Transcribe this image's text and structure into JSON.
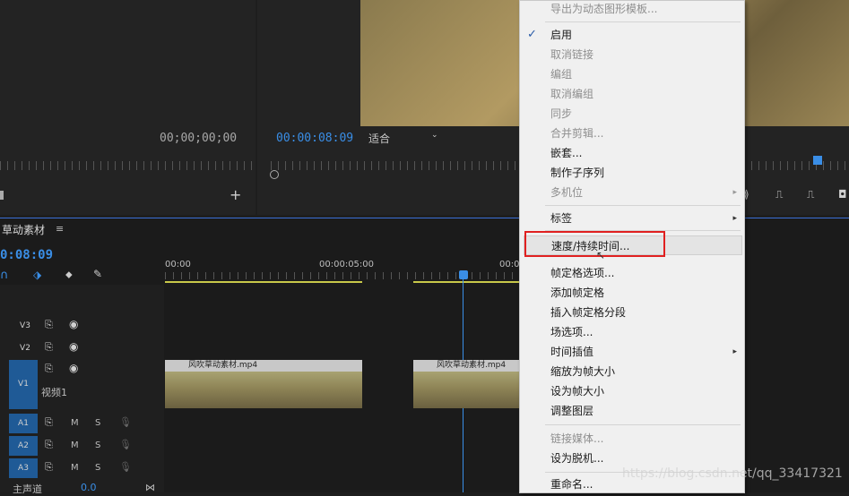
{
  "source": {
    "timecode": "00;00;00;00"
  },
  "program": {
    "timecode": "00:00:08:09",
    "fit": "适合"
  },
  "timeline": {
    "title": "草动素材",
    "timecode": "0:08:09",
    "ruler": [
      "00:00",
      "00:00:05:00",
      "00:0"
    ],
    "tracks": {
      "v3": "V3",
      "v2": "V2",
      "v1": "V1",
      "v1_name": "视频1",
      "a1": "A1",
      "a2": "A2",
      "a3": "A3",
      "m": "M",
      "s": "S",
      "master": "主声道",
      "master_val": "0.0"
    },
    "clips": [
      "风吹草动素材.mp4",
      "风吹草动素材.mp4"
    ]
  },
  "menu": {
    "items": [
      {
        "label": "导出为动态图形模板...",
        "enabled": false
      },
      {
        "label": "启用",
        "enabled": true,
        "checked": true
      },
      {
        "label": "取消链接",
        "enabled": false
      },
      {
        "label": "编组",
        "enabled": false
      },
      {
        "label": "取消编组",
        "enabled": false
      },
      {
        "label": "同步",
        "enabled": false
      },
      {
        "label": "合并剪辑...",
        "enabled": false
      },
      {
        "label": "嵌套...",
        "enabled": true
      },
      {
        "label": "制作子序列",
        "enabled": true
      },
      {
        "label": "多机位",
        "enabled": false,
        "submenu": true
      },
      {
        "label": "标签",
        "enabled": true,
        "submenu": true
      },
      {
        "label": "速度/持续时间...",
        "enabled": true,
        "highlighted": true
      },
      {
        "label": "帧定格选项...",
        "enabled": true
      },
      {
        "label": "添加帧定格",
        "enabled": true
      },
      {
        "label": "插入帧定格分段",
        "enabled": true
      },
      {
        "label": "场选项...",
        "enabled": true
      },
      {
        "label": "时间插值",
        "enabled": true,
        "submenu": true
      },
      {
        "label": "缩放为帧大小",
        "enabled": true
      },
      {
        "label": "设为帧大小",
        "enabled": true
      },
      {
        "label": "调整图层",
        "enabled": true
      },
      {
        "label": "链接媒体...",
        "enabled": false
      },
      {
        "label": "设为脱机...",
        "enabled": true
      },
      {
        "label": "重命名...",
        "enabled": true
      }
    ],
    "check_mark": "✓",
    "arrow": "▸"
  },
  "watermark": "https://blog.csdn.net/qq_33417321",
  "colors": {
    "accent": "#3a8ee6",
    "highlight_border": "#e02020",
    "playhead": "#3a8ee6",
    "track_blue": "#1f5a96"
  }
}
